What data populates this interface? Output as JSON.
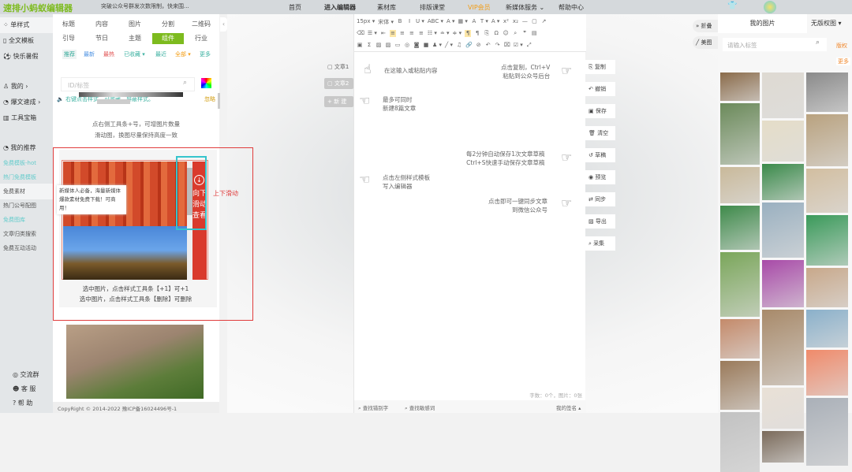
{
  "header": {
    "logo": "速排小蚂蚁编辑器",
    "notice": "突破公众号群发次数限制，快来围...",
    "nav": [
      "首页",
      "进入编辑器",
      "素材库",
      "排版课堂",
      "VIP会员",
      "新媒体服务 ⌄",
      "帮助中心"
    ]
  },
  "leftnav": {
    "items": [
      "单样式",
      "全文模板",
      "快乐暑假",
      "我的",
      "爆文速成",
      "工具宝箱",
      "我的推荐"
    ],
    "subs": [
      "免费模板-hot",
      "热门免费模板",
      "免费素材",
      "热门公号配图",
      "免费图库",
      "文章归类搜索",
      "免费互动活动"
    ],
    "bottom": [
      "交流群",
      "客 服",
      "帮 助"
    ]
  },
  "panel": {
    "cats": [
      "标题",
      "内容",
      "图片",
      "分割",
      "二维码",
      "引导",
      "节日",
      "主题",
      "组件",
      "行业"
    ],
    "filters": [
      "推荐",
      "最新",
      "最热",
      "已收藏 ▾",
      "最近",
      "全部 ▾",
      "更多"
    ],
    "search_placeholder": "ID/标签",
    "tip_line": "右键点击样式，可收藏、屏蔽样式。",
    "tip_action": "忽略",
    "desc1": "点右侧工具条+号，可增图片数量",
    "desc2": "滑动图，换图尽量保持高度一致",
    "overlay_tip": "新媒体人必备，海量新媒体爆款素材免费下载！可商用！",
    "bar_text": "向下滑动查看",
    "caption1": "选中图片，点击样式工具条【+1】可+1",
    "caption2": "选中图片，点击样式工具条【删除】可删除",
    "annotation": "上下滑动",
    "copyright": "CopyRight © 2014-2022 豫ICP备16024496号-1"
  },
  "tabs": [
    "文章1",
    "文章2",
    "+ 新 建"
  ],
  "toolbar": {
    "row1": [
      "15px ▾",
      "宋体 ▾",
      "B",
      "I",
      "U ▾",
      "ABC ▾",
      "A ▾",
      "▦ ▾",
      "A",
      "T ▾",
      "A ▾",
      "x²",
      "x₂",
      "—",
      "▢",
      "↗"
    ],
    "row2": [
      "⌫",
      "☰ ▾",
      "⇤",
      "≡",
      "≡",
      "≡",
      "≡",
      "☷ ▾",
      "≐ ▾",
      "≑ ▾",
      "¶",
      "¶",
      "⎘",
      "Ω",
      "☺",
      "⌕",
      "❞",
      "▤"
    ],
    "row3": [
      "▣",
      "Σ",
      "▨",
      "▨",
      "▭",
      "◎",
      "◙",
      "■",
      "♟ ▾",
      "╱ ▾",
      "♫",
      "🔗",
      "⊘",
      "↶",
      "↷",
      "⌧",
      "☑ ▾",
      "⤢"
    ]
  },
  "hints": [
    "在这输入或粘贴内容",
    "点击复制，Ctrl+V\n粘贴到公众号后台",
    "最多可同时\n新建8篇文章",
    "每2分钟自动保存1次文章草稿\nCtrl+S快速手动保存文章草稿",
    "点击左侧样式模板\n写入编辑器",
    "点击即可一键同步文章\n到微信公众号"
  ],
  "footer": {
    "count": "字数：0个，图片：0张",
    "find_typo": "查找错别字",
    "find_sensitive": "查找敏感词",
    "signature": "我的签名 ▴"
  },
  "rtools": [
    "复制",
    "撤销",
    "保存",
    "清空",
    "草稿",
    "预览",
    "同步",
    "导出",
    "采集"
  ],
  "float": [
    "折叠",
    "美图"
  ],
  "rpanel": {
    "tab1": "我的图片",
    "tab2": "无版权图 ▾",
    "search_placeholder": "请输入标签",
    "copyright": "版权",
    "more": "更多"
  }
}
